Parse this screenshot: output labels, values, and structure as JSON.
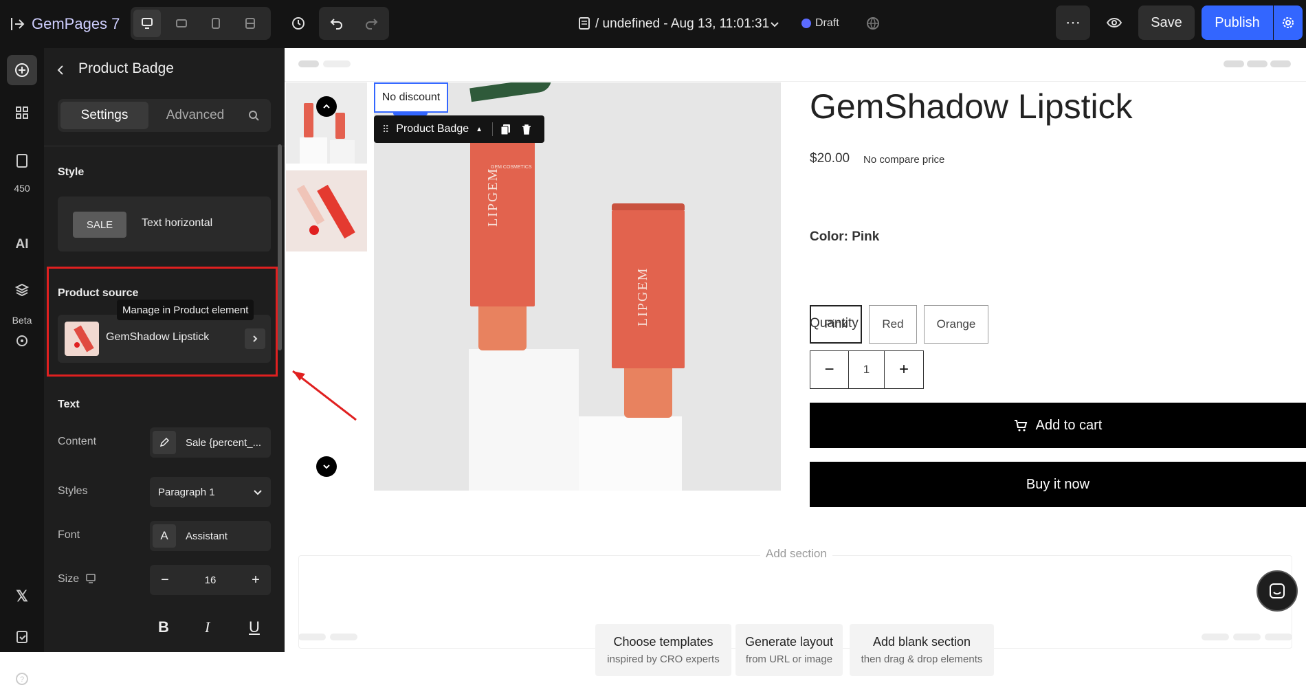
{
  "app": {
    "logo": "GemPages 7"
  },
  "topbar": {
    "page_title": "/ undefined - Aug 13, 11:01:31",
    "status_badge": "Draft",
    "save_label": "Save",
    "publish_label": "Publish"
  },
  "rail": {
    "count_badge": "450",
    "beta_label": "Beta"
  },
  "panel": {
    "title": "Product Badge",
    "tabs": [
      "Settings",
      "Advanced"
    ],
    "style_heading": "Style",
    "style_badge": "SALE",
    "style_label": "Text horizontal",
    "product_source_heading": "Product source",
    "tooltip": "Manage in Product element",
    "product_name": "GemShadow Lipstick",
    "text_heading": "Text",
    "content_label": "Content",
    "content_value": "Sale {percent_...",
    "styles_label": "Styles",
    "styles_value": "Paragraph 1",
    "font_label": "Font",
    "font_value": "Assistant",
    "size_label": "Size",
    "size_value": "16",
    "bold_icon": "B",
    "italic_icon": "I",
    "underline_icon": "U"
  },
  "canvas": {
    "badge_text": "No discount",
    "toolbar_label": "Product Badge",
    "product_title": "GemShadow Lipstick",
    "price": "$20.00",
    "compare_price": "No compare price",
    "color_label": "Color: Pink",
    "variants": [
      "Pink",
      "Red",
      "Orange"
    ],
    "quantity_label": "Quantity",
    "quantity_value": "1",
    "add_to_cart": "Add to cart",
    "buy_now": "Buy it now",
    "add_section": "Add section",
    "cards": [
      {
        "title": "Choose templates",
        "sub": "inspired by CRO experts"
      },
      {
        "title": "Generate layout",
        "sub": "from URL or image"
      },
      {
        "title": "Add blank section",
        "sub": "then drag & drop elements"
      }
    ],
    "brand_text": "LIPGEM",
    "brand_small": "GEM COSMETICS"
  },
  "colors": {
    "accent": "#3366ff",
    "highlight": "#e02020",
    "dark": "#141414"
  }
}
